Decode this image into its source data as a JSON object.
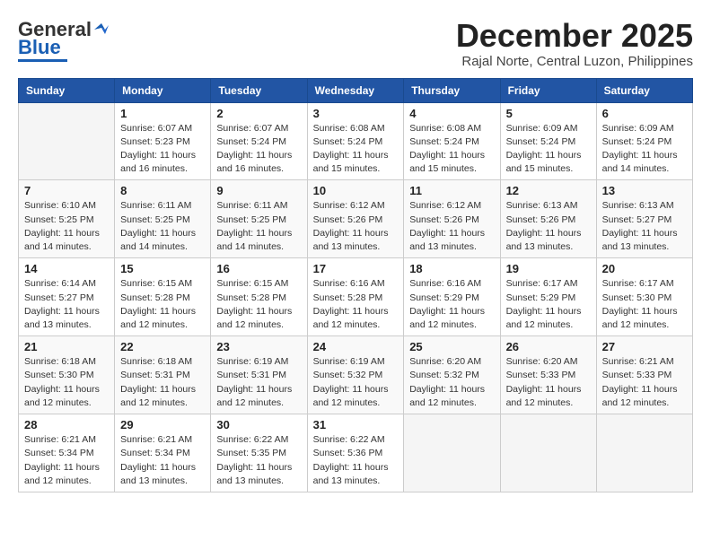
{
  "header": {
    "logo_general": "General",
    "logo_blue": "Blue",
    "month_title": "December 2025",
    "location": "Rajal Norte, Central Luzon, Philippines"
  },
  "days_of_week": [
    "Sunday",
    "Monday",
    "Tuesday",
    "Wednesday",
    "Thursday",
    "Friday",
    "Saturday"
  ],
  "weeks": [
    [
      {
        "day": "",
        "info": ""
      },
      {
        "day": "1",
        "info": "Sunrise: 6:07 AM\nSunset: 5:23 PM\nDaylight: 11 hours\nand 16 minutes."
      },
      {
        "day": "2",
        "info": "Sunrise: 6:07 AM\nSunset: 5:24 PM\nDaylight: 11 hours\nand 16 minutes."
      },
      {
        "day": "3",
        "info": "Sunrise: 6:08 AM\nSunset: 5:24 PM\nDaylight: 11 hours\nand 15 minutes."
      },
      {
        "day": "4",
        "info": "Sunrise: 6:08 AM\nSunset: 5:24 PM\nDaylight: 11 hours\nand 15 minutes."
      },
      {
        "day": "5",
        "info": "Sunrise: 6:09 AM\nSunset: 5:24 PM\nDaylight: 11 hours\nand 15 minutes."
      },
      {
        "day": "6",
        "info": "Sunrise: 6:09 AM\nSunset: 5:24 PM\nDaylight: 11 hours\nand 14 minutes."
      }
    ],
    [
      {
        "day": "7",
        "info": "Sunrise: 6:10 AM\nSunset: 5:25 PM\nDaylight: 11 hours\nand 14 minutes."
      },
      {
        "day": "8",
        "info": "Sunrise: 6:11 AM\nSunset: 5:25 PM\nDaylight: 11 hours\nand 14 minutes."
      },
      {
        "day": "9",
        "info": "Sunrise: 6:11 AM\nSunset: 5:25 PM\nDaylight: 11 hours\nand 14 minutes."
      },
      {
        "day": "10",
        "info": "Sunrise: 6:12 AM\nSunset: 5:26 PM\nDaylight: 11 hours\nand 13 minutes."
      },
      {
        "day": "11",
        "info": "Sunrise: 6:12 AM\nSunset: 5:26 PM\nDaylight: 11 hours\nand 13 minutes."
      },
      {
        "day": "12",
        "info": "Sunrise: 6:13 AM\nSunset: 5:26 PM\nDaylight: 11 hours\nand 13 minutes."
      },
      {
        "day": "13",
        "info": "Sunrise: 6:13 AM\nSunset: 5:27 PM\nDaylight: 11 hours\nand 13 minutes."
      }
    ],
    [
      {
        "day": "14",
        "info": "Sunrise: 6:14 AM\nSunset: 5:27 PM\nDaylight: 11 hours\nand 13 minutes."
      },
      {
        "day": "15",
        "info": "Sunrise: 6:15 AM\nSunset: 5:28 PM\nDaylight: 11 hours\nand 12 minutes."
      },
      {
        "day": "16",
        "info": "Sunrise: 6:15 AM\nSunset: 5:28 PM\nDaylight: 11 hours\nand 12 minutes."
      },
      {
        "day": "17",
        "info": "Sunrise: 6:16 AM\nSunset: 5:28 PM\nDaylight: 11 hours\nand 12 minutes."
      },
      {
        "day": "18",
        "info": "Sunrise: 6:16 AM\nSunset: 5:29 PM\nDaylight: 11 hours\nand 12 minutes."
      },
      {
        "day": "19",
        "info": "Sunrise: 6:17 AM\nSunset: 5:29 PM\nDaylight: 11 hours\nand 12 minutes."
      },
      {
        "day": "20",
        "info": "Sunrise: 6:17 AM\nSunset: 5:30 PM\nDaylight: 11 hours\nand 12 minutes."
      }
    ],
    [
      {
        "day": "21",
        "info": "Sunrise: 6:18 AM\nSunset: 5:30 PM\nDaylight: 11 hours\nand 12 minutes."
      },
      {
        "day": "22",
        "info": "Sunrise: 6:18 AM\nSunset: 5:31 PM\nDaylight: 11 hours\nand 12 minutes."
      },
      {
        "day": "23",
        "info": "Sunrise: 6:19 AM\nSunset: 5:31 PM\nDaylight: 11 hours\nand 12 minutes."
      },
      {
        "day": "24",
        "info": "Sunrise: 6:19 AM\nSunset: 5:32 PM\nDaylight: 11 hours\nand 12 minutes."
      },
      {
        "day": "25",
        "info": "Sunrise: 6:20 AM\nSunset: 5:32 PM\nDaylight: 11 hours\nand 12 minutes."
      },
      {
        "day": "26",
        "info": "Sunrise: 6:20 AM\nSunset: 5:33 PM\nDaylight: 11 hours\nand 12 minutes."
      },
      {
        "day": "27",
        "info": "Sunrise: 6:21 AM\nSunset: 5:33 PM\nDaylight: 11 hours\nand 12 minutes."
      }
    ],
    [
      {
        "day": "28",
        "info": "Sunrise: 6:21 AM\nSunset: 5:34 PM\nDaylight: 11 hours\nand 12 minutes."
      },
      {
        "day": "29",
        "info": "Sunrise: 6:21 AM\nSunset: 5:34 PM\nDaylight: 11 hours\nand 13 minutes."
      },
      {
        "day": "30",
        "info": "Sunrise: 6:22 AM\nSunset: 5:35 PM\nDaylight: 11 hours\nand 13 minutes."
      },
      {
        "day": "31",
        "info": "Sunrise: 6:22 AM\nSunset: 5:36 PM\nDaylight: 11 hours\nand 13 minutes."
      },
      {
        "day": "",
        "info": ""
      },
      {
        "day": "",
        "info": ""
      },
      {
        "day": "",
        "info": ""
      }
    ]
  ]
}
